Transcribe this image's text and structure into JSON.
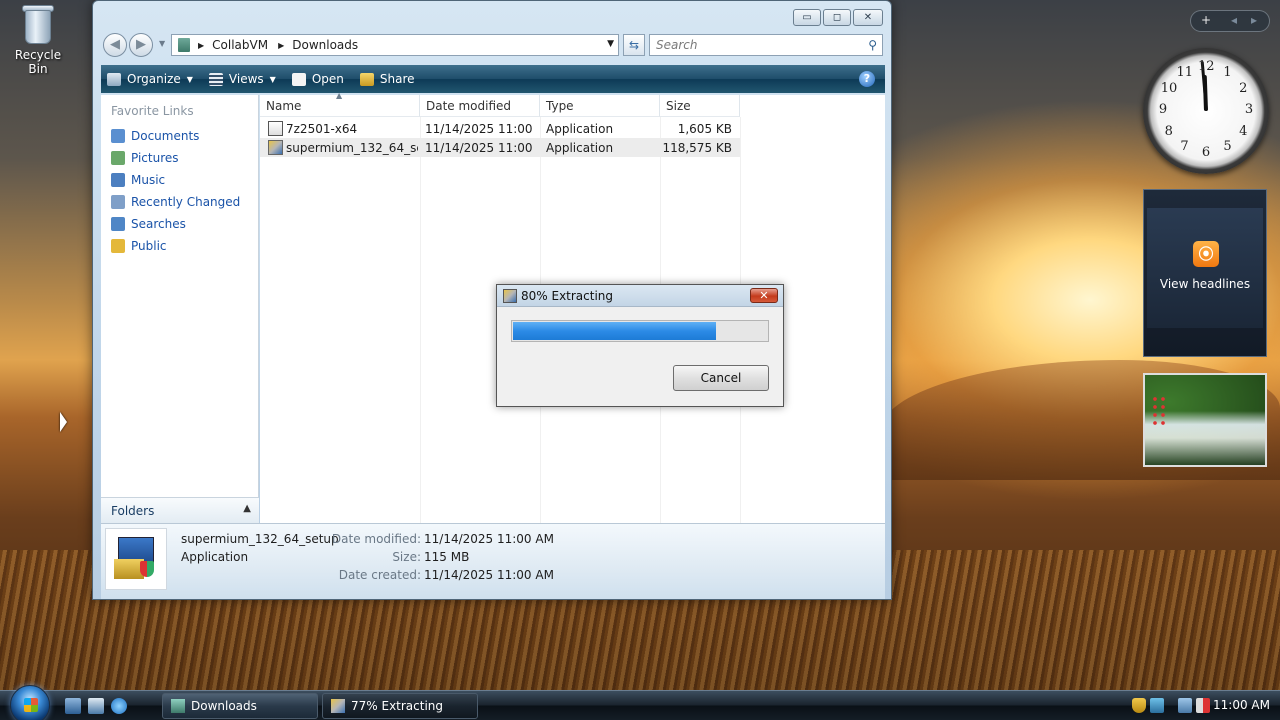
{
  "desktop": {
    "icons": [
      {
        "label": "Recycle Bin",
        "icon": "recycle-bin-icon"
      }
    ]
  },
  "explorer": {
    "window_controls": {
      "minimize": "▭",
      "maximize": "◻",
      "close": "✕"
    },
    "address": {
      "crumbs": [
        "CollabVM",
        "Downloads"
      ]
    },
    "search": {
      "placeholder": "Search"
    },
    "toolbar": {
      "organize": "Organize",
      "views": "Views",
      "open": "Open",
      "share": "Share",
      "help": "?"
    },
    "nav_pane": {
      "title": "Favorite Links",
      "links": [
        {
          "label": "Documents",
          "icon": "documents-icon",
          "color": "#5a8fd0"
        },
        {
          "label": "Pictures",
          "icon": "pictures-icon",
          "color": "#6aa86a"
        },
        {
          "label": "Music",
          "icon": "music-icon",
          "color": "#4c7fc0"
        },
        {
          "label": "Recently Changed",
          "icon": "recently-changed-icon",
          "color": "#7f9fc8"
        },
        {
          "label": "Searches",
          "icon": "searches-icon",
          "color": "#4f86c6"
        },
        {
          "label": "Public",
          "icon": "public-folder-icon",
          "color": "#e4b83a"
        }
      ],
      "folders_label": "Folders"
    },
    "columns": [
      "Name",
      "Date modified",
      "Type",
      "Size"
    ],
    "files": [
      {
        "name": "7z2501-x64",
        "date": "11/14/2025 11:00 ...",
        "type": "Application",
        "size": "1,605 KB",
        "selected": false
      },
      {
        "name": "supermium_132_64_set...",
        "date": "11/14/2025 11:00 ...",
        "type": "Application",
        "size": "118,575 KB",
        "selected": true
      }
    ],
    "details": {
      "name": "supermium_132_64_setup",
      "type": "Application",
      "labels": {
        "modified": "Date modified:",
        "size": "Size:",
        "created": "Date created:"
      },
      "values": {
        "modified": "11/14/2025 11:00 AM",
        "size": "115 MB",
        "created": "11/14/2025 11:00 AM"
      }
    }
  },
  "dialog": {
    "title": "80% Extracting",
    "close": "✕",
    "progress": 0.8,
    "cancel": "Cancel"
  },
  "sidebar": {
    "controls": {
      "add": "+",
      "prev": "◂",
      "next": "▸"
    },
    "clock_numbers": [
      "12",
      "1",
      "2",
      "3",
      "4",
      "5",
      "6",
      "7",
      "8",
      "9",
      "10",
      "11"
    ],
    "feed_label": "View headlines"
  },
  "taskbar": {
    "tasks": [
      {
        "label": "Downloads",
        "icon": "explorer-folder-icon"
      },
      {
        "label": "77% Extracting",
        "icon": "installer-icon"
      }
    ],
    "time": "11:00 AM"
  }
}
